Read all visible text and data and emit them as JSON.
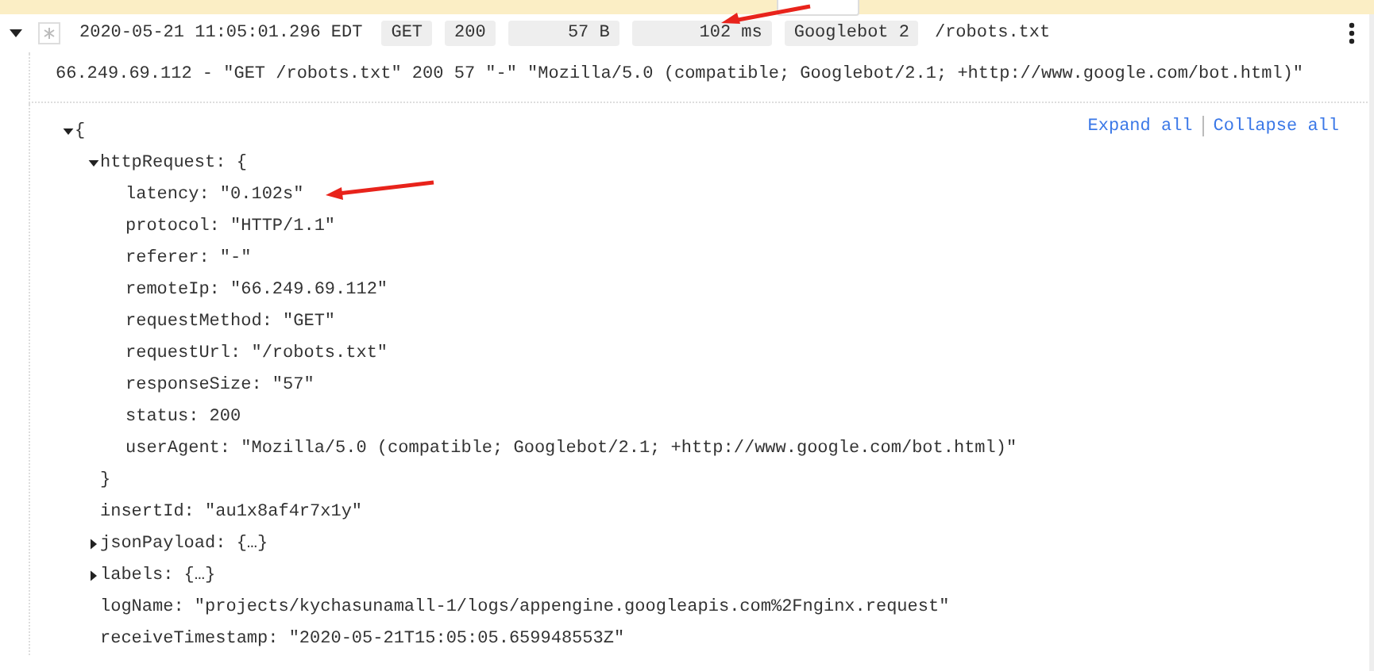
{
  "entry": {
    "expanded": true,
    "timestamp": "2020-05-21 11:05:01.296 EDT",
    "chips": [
      {
        "text": "GET",
        "kind": "text"
      },
      {
        "text": "200",
        "kind": "text"
      },
      {
        "text": "57 B",
        "kind": "numeric"
      },
      {
        "text": "102 ms",
        "kind": "numeric"
      },
      {
        "text": "Googlebot 2",
        "kind": "text"
      }
    ],
    "path": "/robots.txt"
  },
  "summary": "66.249.69.112 - \"GET /robots.txt\" 200 57 \"-\" \"Mozilla/5.0 (compatible; Googlebot/2.1; +http://www.google.com/bot.html)\"",
  "actions": [
    "Expand all",
    "Collapse all"
  ],
  "tree": [
    {
      "label": "{",
      "expanded": true,
      "children": [
        {
          "label": "httpRequest: {",
          "expanded": true,
          "closing": "}",
          "children": [
            {
              "label": "latency: \"0.102s\""
            },
            {
              "label": "protocol: \"HTTP/1.1\""
            },
            {
              "label": "referer: \"-\""
            },
            {
              "label": "remoteIp: \"66.249.69.112\""
            },
            {
              "label": "requestMethod: \"GET\""
            },
            {
              "label": "requestUrl: \"/robots.txt\""
            },
            {
              "label": "responseSize: \"57\""
            },
            {
              "label": "status: 200"
            },
            {
              "label": "userAgent: \"Mozilla/5.0 (compatible; Googlebot/2.1; +http://www.google.com/bot.html)\""
            }
          ]
        },
        {
          "label": "insertId: \"au1x8af4r7x1y\""
        },
        {
          "label": "jsonPayload: {…}",
          "expanded": false
        },
        {
          "label": "labels: {…}",
          "expanded": false
        },
        {
          "label": "logName: \"projects/kychasunamall-1/logs/appengine.googleapis.com%2Fnginx.request\""
        },
        {
          "label": "receiveTimestamp: \"2020-05-21T15:05:05.659948553Z\""
        }
      ]
    }
  ]
}
